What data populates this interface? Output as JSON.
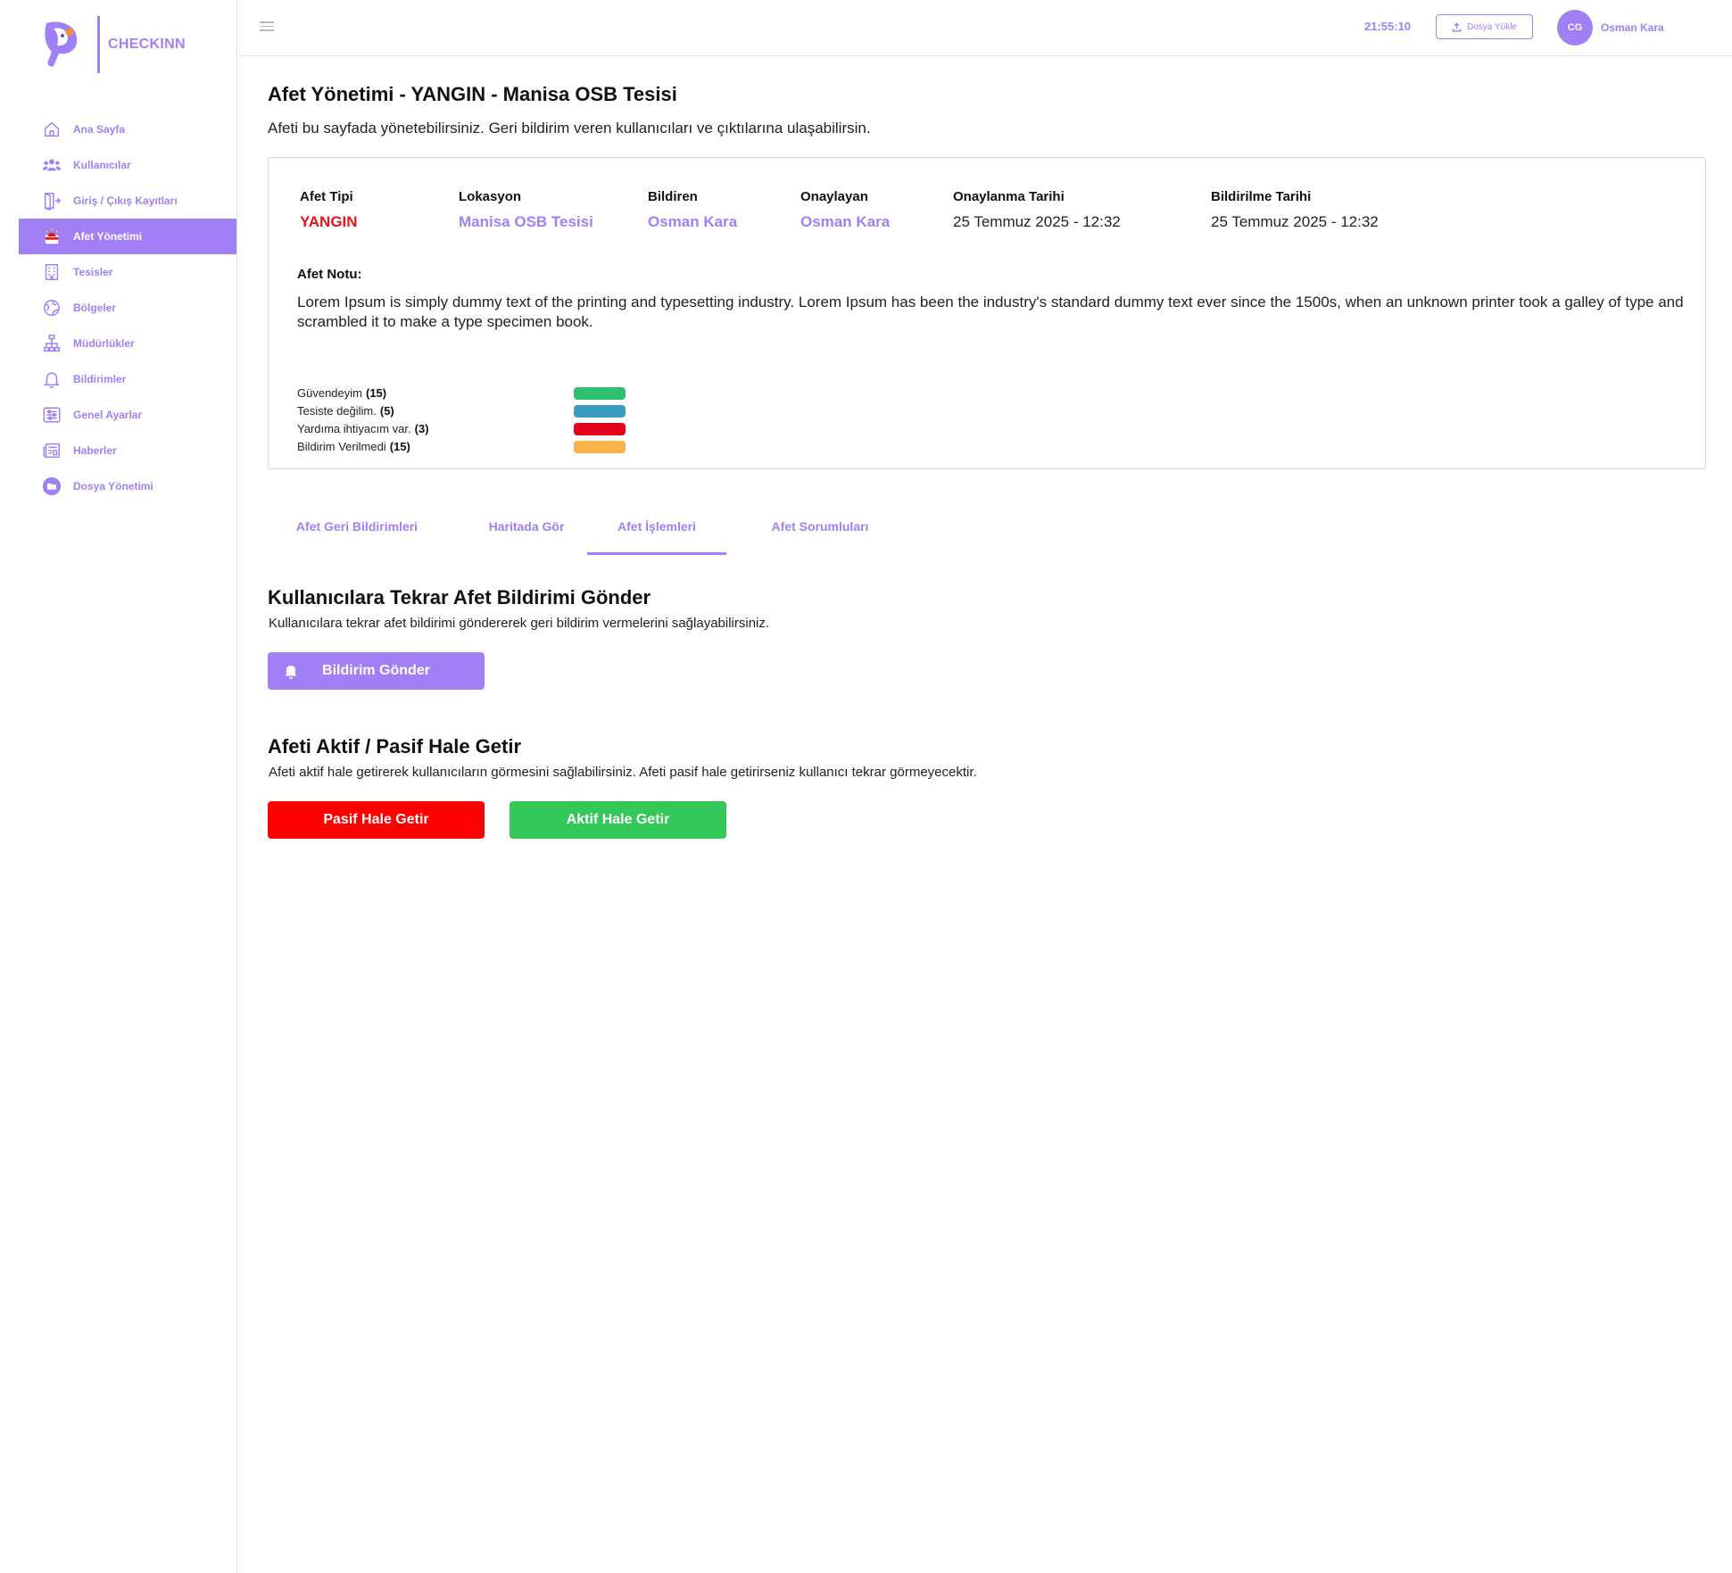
{
  "brand": {
    "name": "CHECKINN",
    "accent": "#a17ff5"
  },
  "sidebar": {
    "items": [
      {
        "label": "Ana Sayfa",
        "icon": "home-icon",
        "active": false
      },
      {
        "label": "Kullanıcılar",
        "icon": "users-icon",
        "active": false
      },
      {
        "label": "Giriş / Çıkış Kayıtları",
        "icon": "door-icon",
        "active": false
      },
      {
        "label": "Afet Yönetimi",
        "icon": "alarm-icon",
        "active": true
      },
      {
        "label": "Tesisler",
        "icon": "building-icon",
        "active": false
      },
      {
        "label": "Bölgeler",
        "icon": "globe-icon",
        "active": false
      },
      {
        "label": "Müdürlükler",
        "icon": "hierarchy-icon",
        "active": false
      },
      {
        "label": "Bildirimler",
        "icon": "bell-icon",
        "active": false
      },
      {
        "label": "Genel Ayarlar",
        "icon": "sliders-icon",
        "active": false
      },
      {
        "label": "Haberler",
        "icon": "newspaper-icon",
        "active": false
      },
      {
        "label": "Dosya Yönetimi",
        "icon": "folder-icon",
        "active": false
      }
    ]
  },
  "topbar": {
    "time": "21:55:10",
    "upload_label": "Dosya Yükle",
    "avatar_initials": "CG",
    "user_name": "Osman Kara"
  },
  "page": {
    "title": "Afet Yönetimi - YANGIN - Manisa OSB Tesisi",
    "subtitle": "Afeti bu sayfada yönetebilirsiniz. Geri bildirim veren kullanıcıları ve çıktılarına ulaşabilirsin."
  },
  "details": {
    "type_label": "Afet Tipi",
    "type_value": "YANGIN",
    "location_label": "Lokasyon",
    "location_value": "Manisa OSB Tesisi",
    "reporter_label": "Bildiren",
    "reporter_value": "Osman Kara",
    "approver_label": "Onaylayan",
    "approver_value": "Osman Kara",
    "approved_date_label": "Onaylanma Tarihi",
    "approved_date_value": "25 Temmuz 2025 - 12:32",
    "reported_date_label": "Bildirilme Tarihi",
    "reported_date_value": "25 Temmuz 2025 - 12:32",
    "note_label": "Afet Notu:",
    "note_text": "Lorem Ipsum is simply dummy text of the printing and typesetting industry. Lorem Ipsum has been the industry's standard dummy text ever since the 1500s, when an unknown printer took a galley of type and scrambled it to make a type specimen book."
  },
  "legend": [
    {
      "label": "Güvendeyim",
      "count": "(15)",
      "color": "#2fbf71"
    },
    {
      "label": "Tesiste değilim.",
      "count": "(5)",
      "color": "#3a9cc0"
    },
    {
      "label": "Yardıma ihtiyacım var.",
      "count": "(3)",
      "color": "#e3001b"
    },
    {
      "label": "Bildirim Verilmedi",
      "count": "(15)",
      "color": "#fbb147"
    }
  ],
  "tabs": [
    {
      "label": "Afet Geri Bildirimleri",
      "active": false
    },
    {
      "label": "Haritada Gör",
      "active": false
    },
    {
      "label": "Afet İşlemleri",
      "active": true
    },
    {
      "label": "Afet Sorumluları",
      "active": false
    }
  ],
  "resend": {
    "title": "Kullanıcılara Tekrar Afet Bildirimi Gönder",
    "description": "Kullanıcılara tekrar afet bildirimi göndererek geri bildirim vermelerini sağlayabilirsiniz.",
    "button_label": "Bildirim Gönder"
  },
  "status": {
    "title": "Afeti Aktif / Pasif Hale Getir",
    "description": "Afeti aktif hale getirerek kullanıcıların görmesini sağlabilirsiniz. Afeti pasif hale getirirseniz kullanıcı tekrar görmeyecektir.",
    "passive_label": "Pasif Hale Getir",
    "active_label": "Aktif Hale Getir",
    "passive_color": "#ff0000",
    "active_color": "#34c759"
  }
}
